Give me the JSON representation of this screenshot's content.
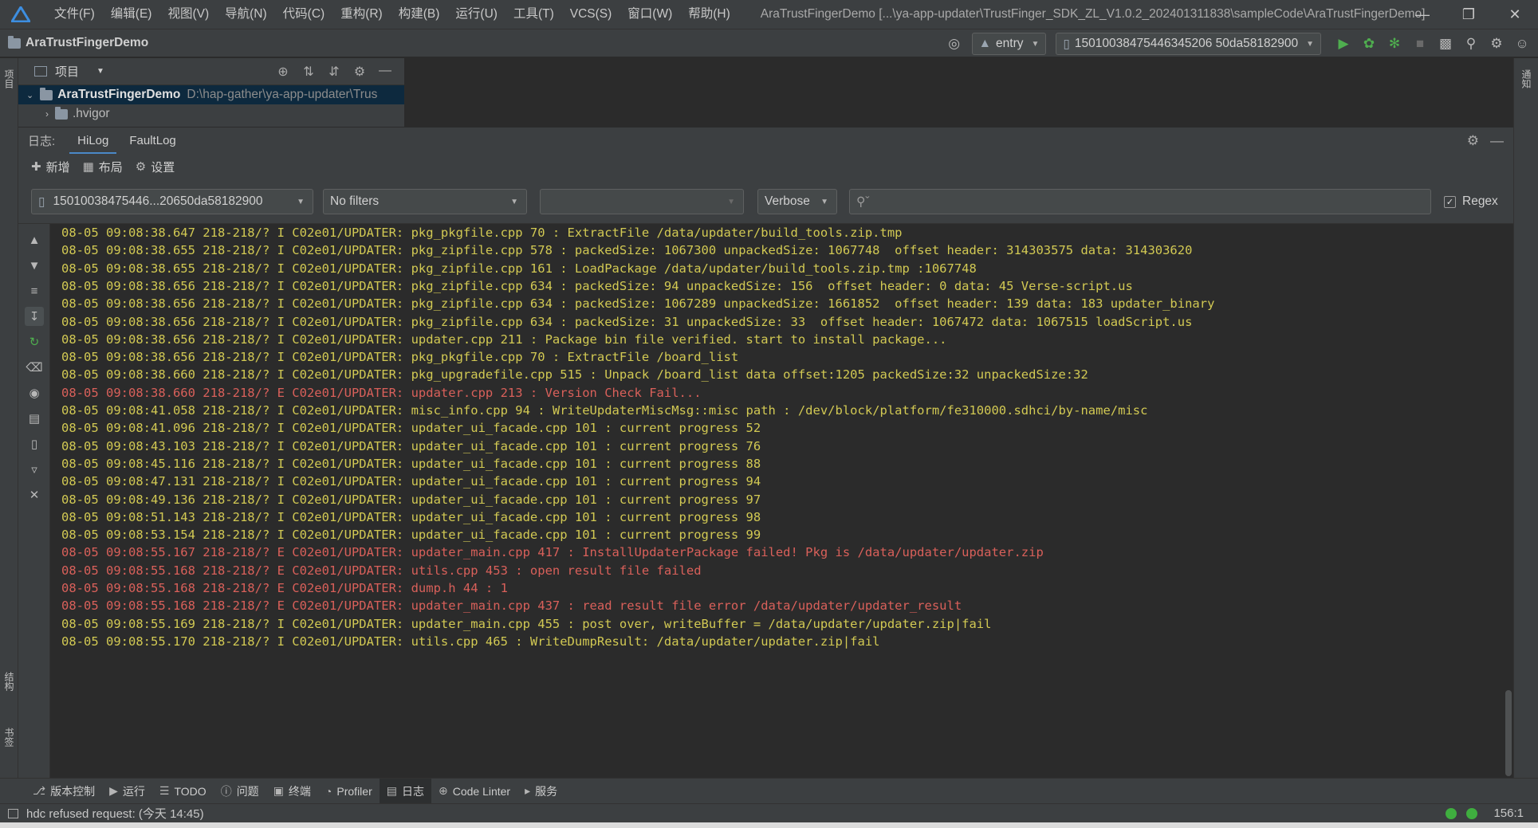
{
  "menu": [
    "文件(F)",
    "编辑(E)",
    "视图(V)",
    "导航(N)",
    "代码(C)",
    "重构(R)",
    "构建(B)",
    "运行(U)",
    "工具(T)",
    "VCS(S)",
    "窗口(W)",
    "帮助(H)"
  ],
  "window_title": "AraTrustFingerDemo [...\\ya-app-updater\\TrustFinger_SDK_ZL_V1.0.2_202401311838\\sampleCode\\AraTrustFingerDemo]",
  "project_name": "AraTrustFingerDemo",
  "run_config": "entry",
  "device": "15010038475446345206 50da58182900",
  "device_label": "150100384754463452 0650da58182900",
  "device_display": "150100384754463452 0650da58182900",
  "device_full": "150100384754463452065 0da58182900",
  "device_id": "15010038475446345 20650da58182900",
  "nav_device": "150100384754463452 0650da58182900",
  "navbar_device": "15010038475446345 20650da58182900",
  "nav": {
    "device": "150100384754463452 0650da58182900"
  },
  "toolbar": {
    "device": "15010038475446345 20650da58182900"
  },
  "navdevice": "15010038475446345206 50da58182900",
  "device_selector": "150100384754463452 0650da58182900",
  "project_panel": {
    "title": "项目",
    "root_name": "AraTrustFingerDemo",
    "root_path": "D:\\hap-gather\\ya-app-updater\\Trus",
    "child": ".hvigor"
  },
  "log_panel": {
    "label": "日志:",
    "tabs": [
      "HiLog",
      "FaultLog"
    ],
    "actions": [
      "新增",
      "布局",
      "设置"
    ],
    "device_filter": "15010038475446...20650da58182900",
    "filter_preset": "No filters",
    "level": "Verbose",
    "regex_label": "Regex"
  },
  "log_lines": [
    {
      "level": "I",
      "text": "08-05 09:08:38.647 218-218/? I C02e01/UPDATER: pkg_pkgfile.cpp 70 : ExtractFile /data/updater/build_tools.zip.tmp"
    },
    {
      "level": "I",
      "text": "08-05 09:08:38.655 218-218/? I C02e01/UPDATER: pkg_zipfile.cpp 578 : packedSize: 1067300 unpackedSize: 1067748  offset header: 314303575 data: 314303620"
    },
    {
      "level": "I",
      "text": "08-05 09:08:38.655 218-218/? I C02e01/UPDATER: pkg_zipfile.cpp 161 : LoadPackage /data/updater/build_tools.zip.tmp :1067748"
    },
    {
      "level": "I",
      "text": "08-05 09:08:38.656 218-218/? I C02e01/UPDATER: pkg_zipfile.cpp 634 : packedSize: 94 unpackedSize: 156  offset header: 0 data: 45 Verse-script.us"
    },
    {
      "level": "I",
      "text": "08-05 09:08:38.656 218-218/? I C02e01/UPDATER: pkg_zipfile.cpp 634 : packedSize: 1067289 unpackedSize: 1661852  offset header: 139 data: 183 updater_binary"
    },
    {
      "level": "I",
      "text": "08-05 09:08:38.656 218-218/? I C02e01/UPDATER: pkg_zipfile.cpp 634 : packedSize: 31 unpackedSize: 33  offset header: 1067472 data: 1067515 loadScript.us"
    },
    {
      "level": "I",
      "text": "08-05 09:08:38.656 218-218/? I C02e01/UPDATER: updater.cpp 211 : Package bin file verified. start to install package..."
    },
    {
      "level": "I",
      "text": "08-05 09:08:38.656 218-218/? I C02e01/UPDATER: pkg_pkgfile.cpp 70 : ExtractFile /board_list"
    },
    {
      "level": "I",
      "text": "08-05 09:08:38.660 218-218/? I C02e01/UPDATER: pkg_upgradefile.cpp 515 : Unpack /board_list data offset:1205 packedSize:32 unpackedSize:32"
    },
    {
      "level": "E",
      "text": "08-05 09:08:38.660 218-218/? E C02e01/UPDATER: updater.cpp 213 : Version Check Fail..."
    },
    {
      "level": "I",
      "text": "08-05 09:08:41.058 218-218/? I C02e01/UPDATER: misc_info.cpp 94 : WriteUpdaterMiscMsg::misc path : /dev/block/platform/fe310000.sdhci/by-name/misc"
    },
    {
      "level": "I",
      "text": "08-05 09:08:41.096 218-218/? I C02e01/UPDATER: updater_ui_facade.cpp 101 : current progress 52"
    },
    {
      "level": "I",
      "text": "08-05 09:08:43.103 218-218/? I C02e01/UPDATER: updater_ui_facade.cpp 101 : current progress 76"
    },
    {
      "level": "I",
      "text": "08-05 09:08:45.116 218-218/? I C02e01/UPDATER: updater_ui_facade.cpp 101 : current progress 88"
    },
    {
      "level": "I",
      "text": "08-05 09:08:47.131 218-218/? I C02e01/UPDATER: updater_ui_facade.cpp 101 : current progress 94"
    },
    {
      "level": "I",
      "text": "08-05 09:08:49.136 218-218/? I C02e01/UPDATER: updater_ui_facade.cpp 101 : current progress 97"
    },
    {
      "level": "I",
      "text": "08-05 09:08:51.143 218-218/? I C02e01/UPDATER: updater_ui_facade.cpp 101 : current progress 98"
    },
    {
      "level": "I",
      "text": "08-05 09:08:53.154 218-218/? I C02e01/UPDATER: updater_ui_facade.cpp 101 : current progress 99"
    },
    {
      "level": "E",
      "text": "08-05 09:08:55.167 218-218/? E C02e01/UPDATER: updater_main.cpp 417 : InstallUpdaterPackage failed! Pkg is /data/updater/updater.zip"
    },
    {
      "level": "E",
      "text": "08-05 09:08:55.168 218-218/? E C02e01/UPDATER: utils.cpp 453 : open result file failed"
    },
    {
      "level": "E",
      "text": "08-05 09:08:55.168 218-218/? E C02e01/UPDATER: dump.h 44 : 1"
    },
    {
      "level": "E",
      "text": "08-05 09:08:55.168 218-218/? E C02e01/UPDATER: updater_main.cpp 437 : read result file error /data/updater/updater_result"
    },
    {
      "level": "I",
      "text": "08-05 09:08:55.169 218-218/? I C02e01/UPDATER: updater_main.cpp 455 : post over, writeBuffer = /data/updater/updater.zip|fail"
    },
    {
      "level": "I",
      "text": "08-05 09:08:55.170 218-218/? I C02e01/UPDATER: utils.cpp 465 : WriteDumpResult: /data/updater/updater.zip|fail"
    }
  ],
  "tool_windows": [
    {
      "label": "版本控制",
      "icon": "branch-icon"
    },
    {
      "label": "运行",
      "icon": "run-icon"
    },
    {
      "label": "TODO",
      "icon": "list-icon"
    },
    {
      "label": "问题",
      "icon": "info-icon"
    },
    {
      "label": "终端",
      "icon": "terminal-icon"
    },
    {
      "label": "Profiler",
      "icon": "gauge-icon"
    },
    {
      "label": "日志",
      "icon": "log-icon",
      "active": true
    },
    {
      "label": "Code Linter",
      "icon": "linter-icon"
    },
    {
      "label": "服务",
      "icon": "services-icon"
    }
  ],
  "left_stripe": [
    "项目",
    "结构",
    "书签"
  ],
  "right_stripe": [
    "通知"
  ],
  "status": {
    "message": "hdc refused request: (今天 14:45)",
    "position": "156:1"
  },
  "colors": {
    "info": "#d2c953",
    "error": "#d9605a",
    "accent": "#4a88c7"
  }
}
